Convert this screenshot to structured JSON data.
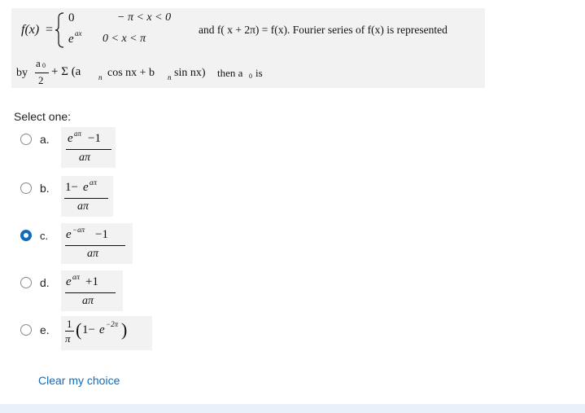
{
  "question": {
    "fx_label": "f(x)",
    "equals": "=",
    "case1_value": "0",
    "case1_condition": "− π < x < 0",
    "case2_value_base": "e",
    "case2_value_exp": "ax",
    "case2_condition": "0 < x < π",
    "periodicity": "and f( x + 2π) = f(x). Fourier series of  f(x) is represented",
    "by_word": "by",
    "a0_num": "a",
    "a0_sub": "0",
    "a0_den": "2",
    "series_tail": "+ Σ (a",
    "series_an_sub": "n",
    "series_cos": "cos nx + b",
    "series_bn_sub": "n",
    "series_sin": "sin nx)",
    "then_text": "then a",
    "then_sub": "0",
    "is_text": "is"
  },
  "select_one_label": "Select one:",
  "options": [
    {
      "letter": "a.",
      "numerator": "e^{aπ} − 1",
      "num_base": "e",
      "num_exp": "aπ",
      "num_rest": " −1",
      "denominator": "aπ",
      "selected": false
    },
    {
      "letter": "b.",
      "numerator": "1 − e^{aπ}",
      "num_pre": "1−",
      "num_base": "e",
      "num_exp": "aπ",
      "denominator": "aπ",
      "selected": false
    },
    {
      "letter": "c.",
      "numerator": "e^{−aπ} − 1",
      "num_base": "e",
      "num_exp": "−aπ",
      "num_rest": " −1",
      "denominator": "aπ",
      "selected": true
    },
    {
      "letter": "d.",
      "numerator": "e^{aπ} + 1",
      "num_base": "e",
      "num_exp": "aπ",
      "num_rest": " +1",
      "denominator": "aπ",
      "selected": false
    },
    {
      "letter": "e.",
      "expression": "(1/π)(1 − e^{−2π})",
      "frac_num": "1",
      "frac_den": "π",
      "paren_open": "(",
      "inner_pre": "1−",
      "inner_base": "e",
      "inner_exp": "−2π",
      "paren_close": ")",
      "selected": false
    }
  ],
  "clear_choice_label": "Clear my choice",
  "colors": {
    "accent": "#0f6cbf",
    "question_bg": "#f2f2f2",
    "page_bg": "#e8f1f9"
  }
}
